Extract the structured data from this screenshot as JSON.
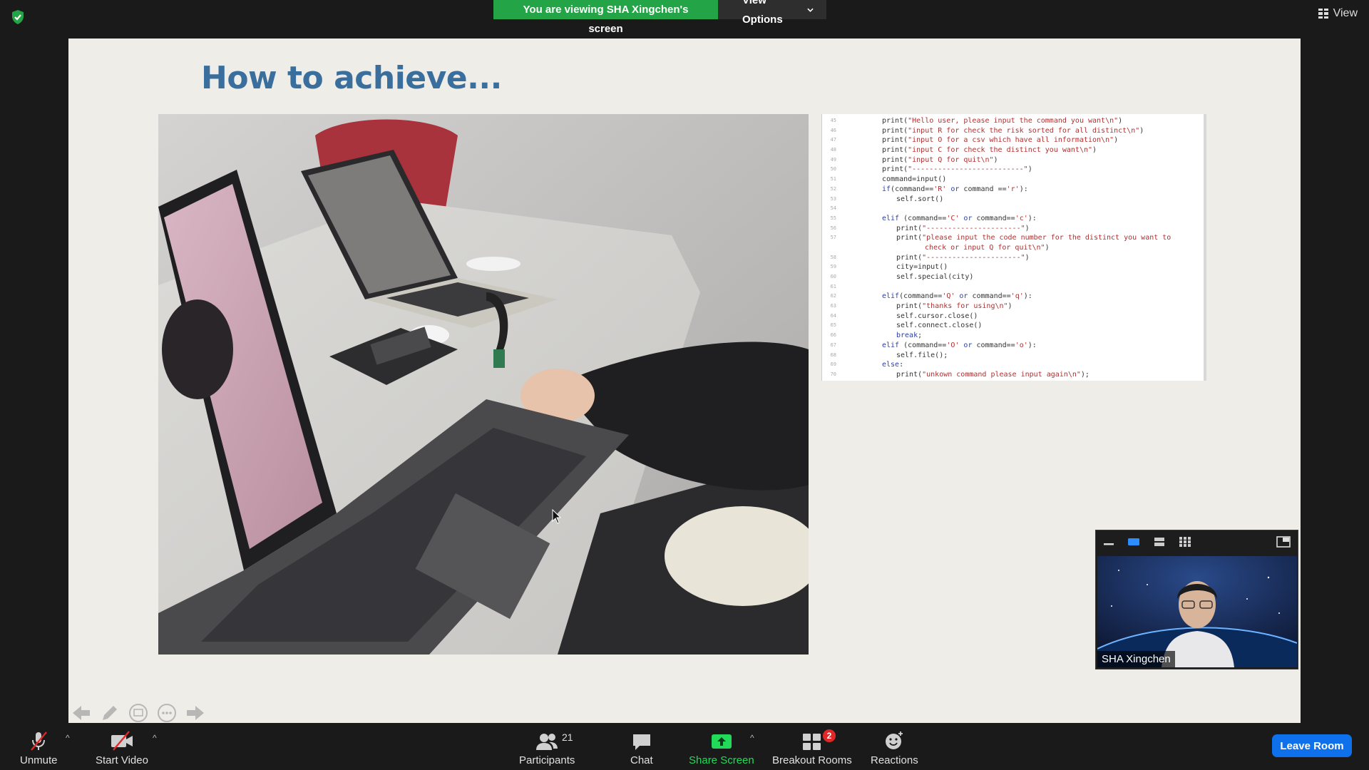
{
  "banner": {
    "viewing_text": "You are viewing SHA Xingchen's screen",
    "view_options_label": "View Options"
  },
  "top_right": {
    "view_label": "View"
  },
  "slide": {
    "title": "How to achieve...",
    "code_lines": [
      {
        "n": "45",
        "indent": 2,
        "parts": [
          [
            "t",
            "print("
          ],
          [
            "s",
            "\"Hello user, please input the command you want\\n\""
          ],
          [
            "t",
            ")"
          ]
        ]
      },
      {
        "n": "46",
        "indent": 2,
        "parts": [
          [
            "t",
            "print("
          ],
          [
            "s",
            "\"input R for check the risk sorted for all distinct\\n\""
          ],
          [
            "t",
            ")"
          ]
        ]
      },
      {
        "n": "47",
        "indent": 2,
        "parts": [
          [
            "t",
            "print("
          ],
          [
            "s",
            "\"input O for a csv which have all information\\n\""
          ],
          [
            "t",
            ")"
          ]
        ]
      },
      {
        "n": "48",
        "indent": 2,
        "parts": [
          [
            "t",
            "print("
          ],
          [
            "s",
            "\"input C for check the distinct you want\\n\""
          ],
          [
            "t",
            ")"
          ]
        ]
      },
      {
        "n": "49",
        "indent": 2,
        "parts": [
          [
            "t",
            "print("
          ],
          [
            "s",
            "\"input Q for quit\\n\""
          ],
          [
            "t",
            ")"
          ]
        ]
      },
      {
        "n": "50",
        "indent": 2,
        "parts": [
          [
            "t",
            "print("
          ],
          [
            "s",
            "\"--------------------------\""
          ],
          [
            "t",
            ")"
          ]
        ]
      },
      {
        "n": "51",
        "indent": 2,
        "parts": [
          [
            "t",
            "command=input()"
          ]
        ]
      },
      {
        "n": "52",
        "indent": 2,
        "parts": [
          [
            "k",
            "if"
          ],
          [
            "t",
            "(command=="
          ],
          [
            "s",
            "'R'"
          ],
          [
            "t",
            " "
          ],
          [
            "k",
            "or"
          ],
          [
            "t",
            " command =="
          ],
          [
            "s",
            "'r'"
          ],
          [
            "t",
            "):"
          ]
        ]
      },
      {
        "n": "53",
        "indent": 3,
        "parts": [
          [
            "t",
            "self.sort()"
          ]
        ]
      },
      {
        "n": "54",
        "indent": 0,
        "parts": [
          [
            "t",
            ""
          ]
        ]
      },
      {
        "n": "55",
        "indent": 2,
        "parts": [
          [
            "k",
            "elif"
          ],
          [
            "t",
            " (command=="
          ],
          [
            "s",
            "'C'"
          ],
          [
            "t",
            " "
          ],
          [
            "k",
            "or"
          ],
          [
            "t",
            " command=="
          ],
          [
            "s",
            "'c'"
          ],
          [
            "t",
            "):"
          ]
        ]
      },
      {
        "n": "56",
        "indent": 3,
        "parts": [
          [
            "t",
            "print("
          ],
          [
            "s",
            "\"----------------------\""
          ],
          [
            "t",
            ")"
          ]
        ]
      },
      {
        "n": "57",
        "indent": 3,
        "parts": [
          [
            "t",
            "print("
          ],
          [
            "s",
            "\"please input the code number for the distinct you want to"
          ]
        ]
      },
      {
        "n": "",
        "indent": 5,
        "parts": [
          [
            "s",
            "check or input Q for quit\\n\""
          ],
          [
            "t",
            ")"
          ]
        ]
      },
      {
        "n": "58",
        "indent": 3,
        "parts": [
          [
            "t",
            "print("
          ],
          [
            "s",
            "\"----------------------\""
          ],
          [
            "t",
            ")"
          ]
        ]
      },
      {
        "n": "59",
        "indent": 3,
        "parts": [
          [
            "t",
            "city=input()"
          ]
        ]
      },
      {
        "n": "60",
        "indent": 3,
        "parts": [
          [
            "t",
            "self.special(city)"
          ]
        ]
      },
      {
        "n": "61",
        "indent": 0,
        "parts": [
          [
            "t",
            ""
          ]
        ]
      },
      {
        "n": "62",
        "indent": 2,
        "parts": [
          [
            "k",
            "elif"
          ],
          [
            "t",
            "(command=="
          ],
          [
            "s",
            "'Q'"
          ],
          [
            "t",
            " "
          ],
          [
            "k",
            "or"
          ],
          [
            "t",
            " command=="
          ],
          [
            "s",
            "'q'"
          ],
          [
            "t",
            "):"
          ]
        ]
      },
      {
        "n": "63",
        "indent": 3,
        "parts": [
          [
            "t",
            "print("
          ],
          [
            "s",
            "\"thanks for using\\n\""
          ],
          [
            "t",
            ")"
          ]
        ]
      },
      {
        "n": "64",
        "indent": 3,
        "parts": [
          [
            "t",
            "self.cursor.close()"
          ]
        ]
      },
      {
        "n": "65",
        "indent": 3,
        "parts": [
          [
            "t",
            "self.connect.close()"
          ]
        ]
      },
      {
        "n": "66",
        "indent": 3,
        "parts": [
          [
            "k",
            "break"
          ],
          [
            "t",
            ";"
          ]
        ]
      },
      {
        "n": "67",
        "indent": 2,
        "parts": [
          [
            "k",
            "elif"
          ],
          [
            "t",
            " (command=="
          ],
          [
            "s",
            "'O'"
          ],
          [
            "t",
            " "
          ],
          [
            "k",
            "or"
          ],
          [
            "t",
            " command=="
          ],
          [
            "s",
            "'o'"
          ],
          [
            "t",
            "):"
          ]
        ]
      },
      {
        "n": "68",
        "indent": 3,
        "parts": [
          [
            "t",
            "self.file();"
          ]
        ]
      },
      {
        "n": "69",
        "indent": 2,
        "parts": [
          [
            "k",
            "else"
          ],
          [
            "t",
            ":"
          ]
        ]
      },
      {
        "n": "70",
        "indent": 3,
        "parts": [
          [
            "t",
            "print("
          ],
          [
            "s",
            "\"unkown command please input again\\n\""
          ],
          [
            "t",
            ");"
          ]
        ]
      }
    ]
  },
  "self_view": {
    "name": "SHA Xingchen"
  },
  "toolbar": {
    "unmute_label": "Unmute",
    "start_video_label": "Start Video",
    "participants_label": "Participants",
    "participants_count": "21",
    "chat_label": "Chat",
    "share_screen_label": "Share Screen",
    "breakout_rooms_label": "Breakout Rooms",
    "breakout_badge": "2",
    "reactions_label": "Reactions",
    "leave_label": "Leave Room"
  },
  "colors": {
    "banner_green": "#23a547",
    "share_green": "#23d959",
    "leave_blue": "#0e71eb",
    "slide_title": "#3a6e9d",
    "badge_red": "#e02828"
  }
}
